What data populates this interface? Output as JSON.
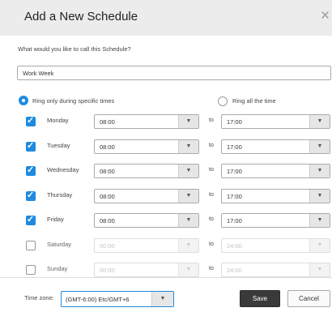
{
  "dialog": {
    "title": "Add a New Schedule",
    "close_glyph": "×"
  },
  "schedule_name": {
    "prompt": "What would you like to call this Schedule?",
    "value": "Work Week"
  },
  "ring_mode": {
    "specific_label": "Ring only during specific times",
    "all_label": "Ring all the time",
    "selected": "specific"
  },
  "to_label": "to",
  "days": [
    {
      "label": "Monday",
      "enabled": true,
      "start": "08:00",
      "end": "17:00"
    },
    {
      "label": "Tuesday",
      "enabled": true,
      "start": "08:00",
      "end": "17:00"
    },
    {
      "label": "Wednesday",
      "enabled": true,
      "start": "08:00",
      "end": "17:00"
    },
    {
      "label": "Thursday",
      "enabled": true,
      "start": "08:00",
      "end": "17:00"
    },
    {
      "label": "Friday",
      "enabled": true,
      "start": "08:00",
      "end": "17:00"
    },
    {
      "label": "Saturday",
      "enabled": false,
      "start": "00:00",
      "end": "24:00"
    },
    {
      "label": "Sunday",
      "enabled": false,
      "start": "00:00",
      "end": "24:00"
    }
  ],
  "time_zone": {
    "label": "Time zone:",
    "value": "(GMT-6:00) Etc/GMT+6"
  },
  "buttons": {
    "save": "Save",
    "cancel": "Cancel"
  },
  "icons": {
    "dropdown_arrow": "▼",
    "check": "✓"
  },
  "colors": {
    "accent": "#1f8be0",
    "title_bar": "#ececec",
    "save_button": "#3a3a3a"
  }
}
